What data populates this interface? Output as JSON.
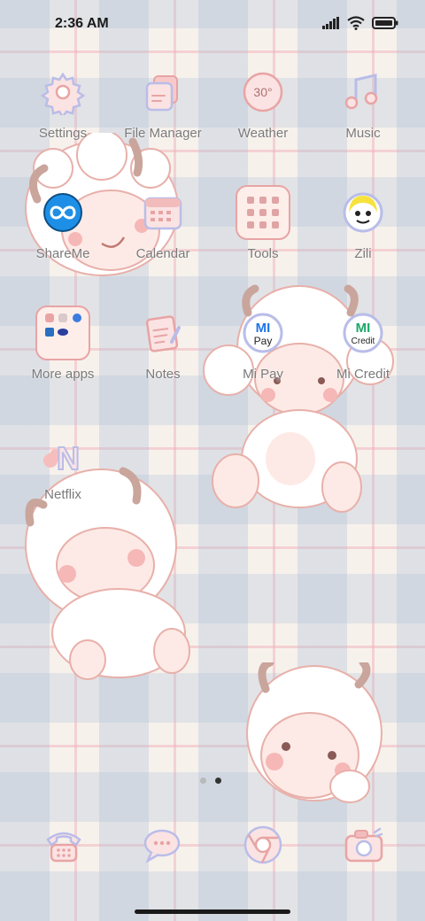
{
  "status": {
    "time": "2:36 AM",
    "icons": [
      "signal-icon",
      "wifi-icon",
      "battery-icon"
    ]
  },
  "apps": [
    {
      "label": "Settings",
      "icon": "gear-icon"
    },
    {
      "label": "File Manager",
      "icon": "folder-icon"
    },
    {
      "label": "Weather",
      "icon": "weather-icon",
      "badge": "30°"
    },
    {
      "label": "Music",
      "icon": "music-note-icon"
    },
    {
      "label": "ShareMe",
      "icon": "shareme-icon"
    },
    {
      "label": "Calendar",
      "icon": "calendar-icon"
    },
    {
      "label": "Tools",
      "icon": "tools-folder-icon"
    },
    {
      "label": "Zili",
      "icon": "zili-icon"
    },
    {
      "label": "More apps",
      "icon": "more-apps-folder-icon"
    },
    {
      "label": "Notes",
      "icon": "notes-icon"
    },
    {
      "label": "Mi Pay",
      "icon": "mi-pay-icon",
      "badge_top": "MI",
      "badge_bottom": "Pay"
    },
    {
      "label": "Mi Credit",
      "icon": "mi-credit-icon",
      "badge_top": "MI",
      "badge_bottom": "Credit"
    },
    {
      "label": "Netflix",
      "icon": "netflix-icon",
      "badge": "N"
    }
  ],
  "pager": {
    "pages": 2,
    "current": 2
  },
  "dock": [
    {
      "icon": "phone-icon"
    },
    {
      "icon": "messages-icon"
    },
    {
      "icon": "browser-icon"
    },
    {
      "icon": "camera-icon"
    }
  ],
  "colors": {
    "pink_outline": "#e8a4a4",
    "lavender_outline": "#b9bde8",
    "pink_fill": "#fbe3e3",
    "label": "#7a7a7a"
  }
}
